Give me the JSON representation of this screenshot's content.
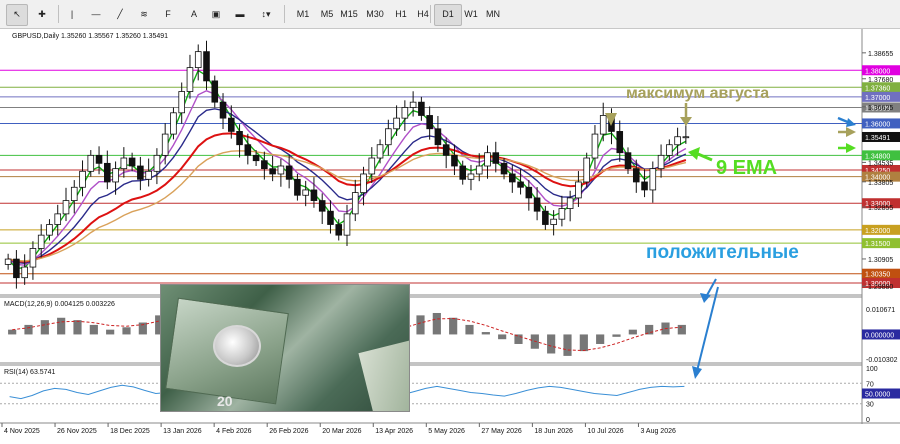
{
  "toolbar": {
    "timeframes": [
      "M1",
      "M5",
      "M15",
      "M30",
      "H1",
      "H4",
      "D1",
      "W1",
      "MN"
    ],
    "active_timeframe": "D1"
  },
  "chart_data": [
    {
      "type": "line",
      "subtype": "candlestick-with-moving-averages",
      "header": "GBPUSD,Daily  1.35260 1.35567 1.35260 1.35491",
      "x_tick_labels": [
        "4 Nov 2025",
        "26 Nov 2025",
        "18 Dec 2025",
        "13 Jan 2026",
        "4 Feb 2026",
        "26 Feb 2026",
        "20 Mar 2026",
        "13 Apr 2026",
        "5 May 2026",
        "27 May 2026",
        "18 Jun 2026",
        "10 Jul 2026",
        "3 Aug 2026"
      ],
      "y_tick_labels": [
        "1.38655",
        "1.37680",
        "1.36625",
        "1.35585",
        "1.34535",
        "1.33805",
        "1.32855",
        "1.30905",
        "1.29880"
      ],
      "ylim": [
        1.297,
        1.391
      ],
      "close_series": [
        1.309,
        1.302,
        1.306,
        1.313,
        1.318,
        1.322,
        1.326,
        1.331,
        1.336,
        1.342,
        1.348,
        1.345,
        1.338,
        1.343,
        1.347,
        1.344,
        1.339,
        1.342,
        1.348,
        1.356,
        1.364,
        1.372,
        1.381,
        1.387,
        1.376,
        1.368,
        1.362,
        1.357,
        1.352,
        1.348,
        1.346,
        1.343,
        1.341,
        1.344,
        1.339,
        1.333,
        1.335,
        1.331,
        1.327,
        1.322,
        1.318,
        1.326,
        1.334,
        1.341,
        1.347,
        1.352,
        1.358,
        1.362,
        1.366,
        1.368,
        1.363,
        1.358,
        1.352,
        1.348,
        1.344,
        1.339,
        1.341,
        1.344,
        1.349,
        1.345,
        1.341,
        1.338,
        1.336,
        1.332,
        1.327,
        1.322,
        1.324,
        1.328,
        1.332,
        1.338,
        1.347,
        1.356,
        1.363,
        1.357,
        1.349,
        1.343,
        1.338,
        1.335,
        1.343,
        1.348,
        1.352,
        1.355,
        1.355
      ],
      "series": [
        {
          "name": "9 EMA",
          "color": "#11aa11"
        },
        {
          "color": "#b050c8"
        },
        {
          "color": "#2a2a8a"
        },
        {
          "color": "#dd1111"
        },
        {
          "color": "#d9a15a"
        }
      ],
      "horizontal_levels": [
        {
          "value": "1.38000",
          "color": "#e000e0"
        },
        {
          "value": "1.37360",
          "color": "#80b040"
        },
        {
          "value": "1.37000",
          "color": "#7070c0"
        },
        {
          "value": "1.36600",
          "color": "#808080"
        },
        {
          "value": "1.36000",
          "color": "#4060c0"
        },
        {
          "value": "1.34800",
          "color": "#40c040"
        },
        {
          "value": "1.34250",
          "color": "#c03030"
        },
        {
          "value": "1.34000",
          "color": "#b08040"
        },
        {
          "value": "1.33000",
          "color": "#c03030"
        },
        {
          "value": "1.32000",
          "color": "#c8a020"
        },
        {
          "value": "1.31500",
          "color": "#90c030"
        },
        {
          "value": "1.30350",
          "color": "#c05010"
        },
        {
          "value": "1.30000",
          "color": "#c03030"
        }
      ],
      "price_tag": {
        "value": "1.35491",
        "color": "#111111"
      },
      "annotations": {
        "august_high": "максимум августа",
        "ema_label": "9 EMA",
        "positive": "положительные"
      }
    },
    {
      "type": "bar",
      "header": "MACD(12,26,9) 0.004125 0.003226",
      "y_tick_labels": [
        "0.010671",
        "0.000000",
        "-0.010302"
      ],
      "values": [
        0.002,
        0.004,
        0.006,
        0.007,
        0.006,
        0.004,
        0.002,
        0.003,
        0.005,
        0.008,
        0.01,
        0.009,
        0.006,
        0.003,
        0.001,
        -0.002,
        -0.004,
        -0.006,
        -0.007,
        -0.006,
        -0.004,
        -0.002,
        0.001,
        0.004,
        0.006,
        0.008,
        0.009,
        0.007,
        0.004,
        0.001,
        -0.002,
        -0.004,
        -0.006,
        -0.008,
        -0.009,
        -0.007,
        -0.004,
        -0.001,
        0.002,
        0.004,
        0.005,
        0.004
      ],
      "signal_color": "#cc2222",
      "zero_tag": {
        "value": "0.000000",
        "color": "#2a2aa0"
      }
    },
    {
      "type": "line",
      "header": "RSI(14) 63.5741",
      "y_tick_labels": [
        "100",
        "70",
        "50",
        "30",
        "0"
      ],
      "ylim": [
        0,
        100
      ],
      "values": [
        44,
        40,
        46,
        55,
        60,
        58,
        52,
        48,
        55,
        62,
        66,
        63,
        56,
        50,
        52,
        58,
        64,
        70,
        72,
        66,
        58,
        54,
        52,
        50,
        48,
        46,
        50,
        56,
        60,
        58,
        54,
        50,
        46,
        44,
        42,
        48,
        54,
        60,
        64,
        60,
        56,
        52,
        50,
        47,
        45,
        50,
        56,
        61,
        64,
        62,
        58,
        54,
        50,
        48,
        46,
        52,
        58,
        62,
        64,
        63,
        64
      ],
      "line_color": "#3a8fd6",
      "level_tag": {
        "value": "50.0000",
        "color": "#2a2aa0"
      }
    }
  ]
}
